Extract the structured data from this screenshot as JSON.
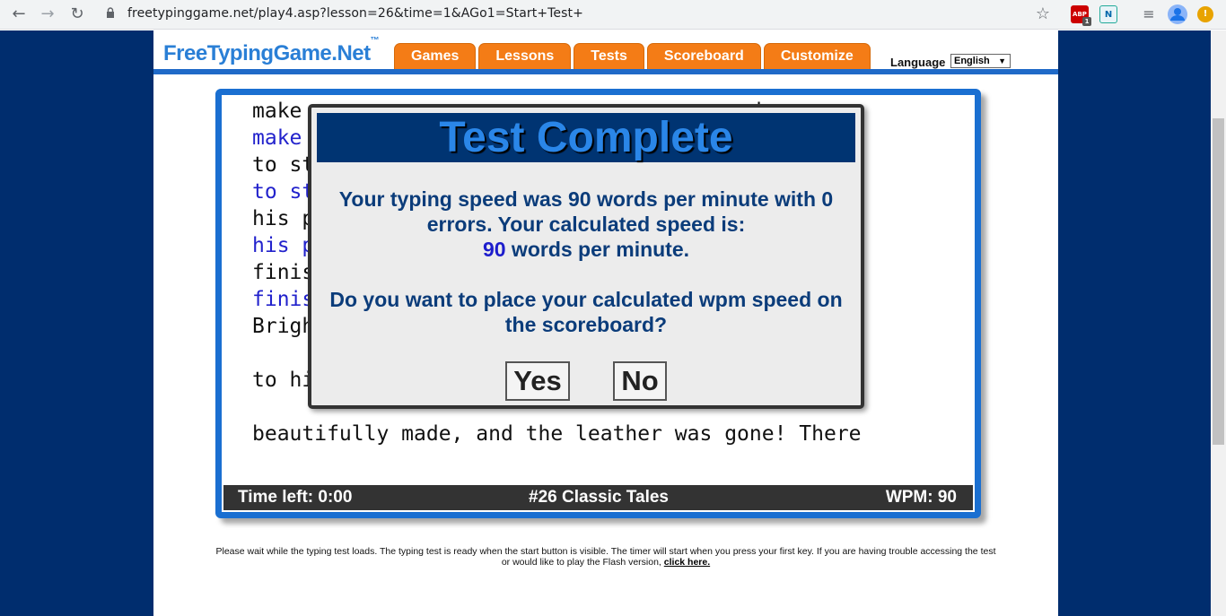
{
  "browser": {
    "url": "freetypinggame.net/play4.asp?lesson=26&time=1&AGo1=Start+Test+",
    "back_glyph": "←",
    "forward_glyph": "→",
    "reload_glyph": "↻",
    "star_glyph": "☆",
    "menu_glyph": "≡",
    "ext_abp": "ABP",
    "ext_abp_count": "1",
    "ext_n": "N",
    "alert_glyph": "!"
  },
  "site": {
    "logo": "FreeTypingGame.Net",
    "logo_tm": "™",
    "tabs": [
      "Games",
      "Lessons",
      "Tests",
      "Scoreboard",
      "Customize"
    ],
    "language_label": "Language",
    "language_value": "English"
  },
  "typing": {
    "lines": [
      {
        "text": "make                                  eady",
        "kind": "ref"
      },
      {
        "text": "make                                  eady",
        "kind": "typed"
      },
      {
        "text": "to st                                 said",
        "kind": "ref"
      },
      {
        "text": "to st                                 said",
        "kind": "typed"
      },
      {
        "text": "his p                                 ould",
        "kind": "ref"
      },
      {
        "text": "his p                                 ould",
        "kind": "typed"
      },
      {
        "text": "finis",
        "kind": "ref"
      },
      {
        "text": "finis",
        "kind": "typed"
      },
      {
        "text": "Brigh                                 went",
        "kind": "ref"
      },
      {
        "text": "to hi",
        "kind": "ref"
      },
      {
        "text": "beautifully made, and the leather was gone! There",
        "kind": "ref"
      }
    ],
    "time_left": "Time left: 0:00",
    "lesson_name": "#26 Classic Tales",
    "wpm": "WPM: 90"
  },
  "modal": {
    "title": "Test Complete",
    "msg_line1": "Your typing speed was 90 words per minute with 0",
    "msg_line2": "errors. Your calculated speed is:",
    "calc_speed": "90",
    "msg_line3_suffix": " words per minute.",
    "question_line1": "Do you want to place your calculated wpm speed on",
    "question_line2": "the scoreboard?",
    "yes": "Yes",
    "no": "No"
  },
  "footer": {
    "note": "Please wait while the typing test loads. The typing test is ready when the start button is visible. The timer will start when you press your first key. If you are having trouble accessing the test or would like to play the Flash version, ",
    "link": "click here."
  },
  "colors": {
    "page_bg": "#002d6e",
    "tab_orange": "#f47c16",
    "accent_blue": "#1a6fd1",
    "modal_title_bg": "#003472"
  }
}
